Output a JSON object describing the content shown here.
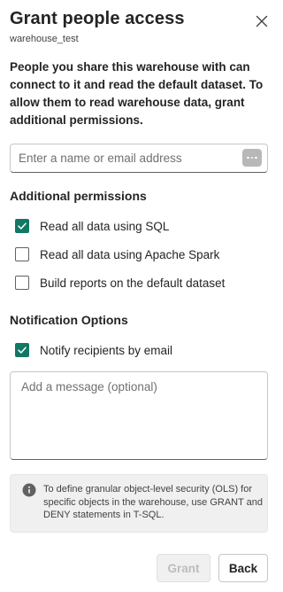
{
  "dialog": {
    "title": "Grant people access",
    "subtitle": "warehouse_test",
    "description": "People you share this warehouse with can connect to it and read the default dataset. To allow them to read warehouse data, grant additional permissions."
  },
  "recipient_input": {
    "placeholder": "Enter a name or email address",
    "value": ""
  },
  "permissions": {
    "heading": "Additional permissions",
    "items": [
      {
        "label": "Read all data using SQL",
        "checked": true
      },
      {
        "label": "Read all data using Apache Spark",
        "checked": false
      },
      {
        "label": "Build reports on the default dataset",
        "checked": false
      }
    ]
  },
  "notifications": {
    "heading": "Notification Options",
    "notify_label": "Notify recipients by email",
    "notify_checked": true,
    "message_placeholder": "Add a message (optional)",
    "message_value": ""
  },
  "info": {
    "text": "To define granular object-level security (OLS) for specific objects in the warehouse, use GRANT and DENY statements in T-SQL."
  },
  "buttons": {
    "grant_label": "Grant",
    "grant_enabled": false,
    "back_label": "Back"
  },
  "colors": {
    "accent": "#117865",
    "disabled_text": "#bdbdbd",
    "info_background": "#f0f0f0"
  },
  "icons": {
    "close": "close-icon",
    "more": "more-horizontal-icon",
    "info": "info-icon",
    "check": "checkmark-icon"
  }
}
